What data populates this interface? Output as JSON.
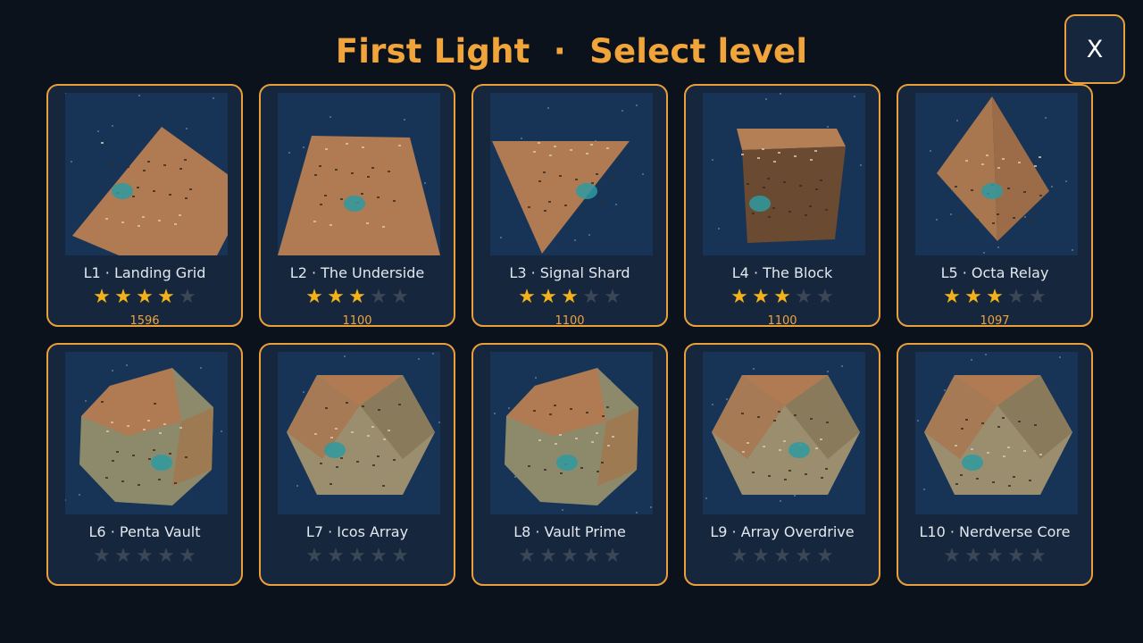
{
  "header": {
    "title": "First Light  ·  Select level",
    "close_label": "X"
  },
  "levels": [
    {
      "name": "L1 · Landing Grid",
      "stars": 4,
      "score": "1596",
      "shape": "square"
    },
    {
      "name": "L2 · The Underside",
      "stars": 3,
      "score": "1100",
      "shape": "trapezoid"
    },
    {
      "name": "L3 · Signal Shard",
      "stars": 3,
      "score": "1100",
      "shape": "triangle"
    },
    {
      "name": "L4 · The Block",
      "stars": 3,
      "score": "1100",
      "shape": "cube"
    },
    {
      "name": "L5 · Octa Relay",
      "stars": 3,
      "score": "1097",
      "shape": "octahedron"
    },
    {
      "name": "L6 · Penta Vault",
      "stars": 0,
      "score": "",
      "shape": "dodecahedron"
    },
    {
      "name": "L7 · Icos Array",
      "stars": 0,
      "score": "",
      "shape": "icosahedron"
    },
    {
      "name": "L8 · Vault Prime",
      "stars": 0,
      "score": "",
      "shape": "dodecahedron"
    },
    {
      "name": "L9 · Array Overdrive",
      "stars": 0,
      "score": "",
      "shape": "icosahedron"
    },
    {
      "name": "L10 · Nerdverse Core",
      "stars": 0,
      "score": "",
      "shape": "icosahedron"
    }
  ],
  "max_stars": 5,
  "colors": {
    "accent": "#f0a43a",
    "card_bg": "#16263c",
    "background": "#0b121c",
    "star_on": "#f3b21b",
    "star_off": "#3b4757",
    "space": "#173456",
    "terrain": "#b07a52"
  }
}
